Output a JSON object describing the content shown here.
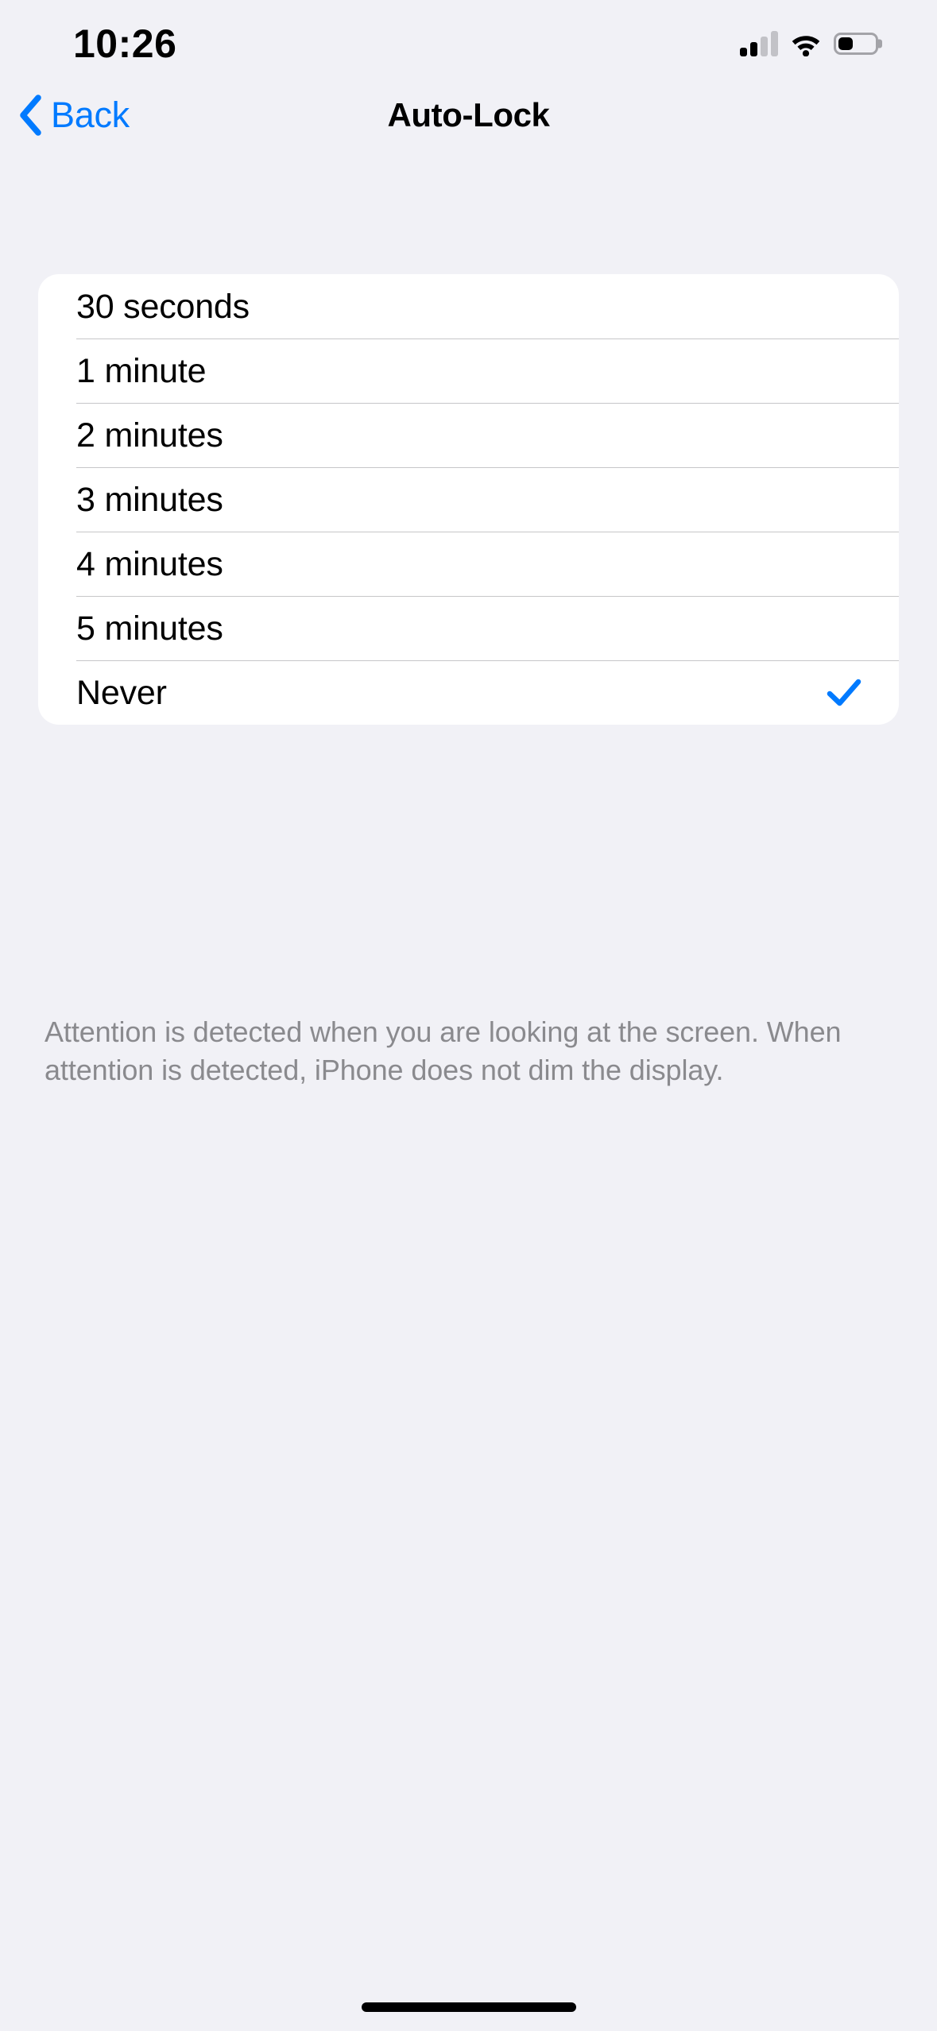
{
  "status_bar": {
    "time": "10:26",
    "cellular_icon": "cellular-signal-icon",
    "cellular_bars_filled": 2,
    "cellular_bars_total": 4,
    "wifi_icon": "wifi-icon",
    "battery_icon": "battery-icon",
    "battery_level_percent": 40
  },
  "nav": {
    "back_label": "Back",
    "back_icon": "chevron-left-icon",
    "title": "Auto-Lock"
  },
  "colors": {
    "accent": "#007AFF",
    "page_background": "#F1F1F6",
    "card_background": "#FFFFFF",
    "separator": "#C6C6C8",
    "footer_text": "#8A8A8E"
  },
  "options": [
    {
      "label": "30 seconds",
      "selected": false
    },
    {
      "label": "1 minute",
      "selected": false
    },
    {
      "label": "2 minutes",
      "selected": false
    },
    {
      "label": "3 minutes",
      "selected": false
    },
    {
      "label": "4 minutes",
      "selected": false
    },
    {
      "label": "5 minutes",
      "selected": false
    },
    {
      "label": "Never",
      "selected": true
    }
  ],
  "selected_option": "Never",
  "checkmark_icon": "checkmark-icon",
  "footer_note": "Attention is detected when you are looking at the screen. When attention is detected, iPhone does not dim the display.",
  "home_indicator": "home-indicator"
}
